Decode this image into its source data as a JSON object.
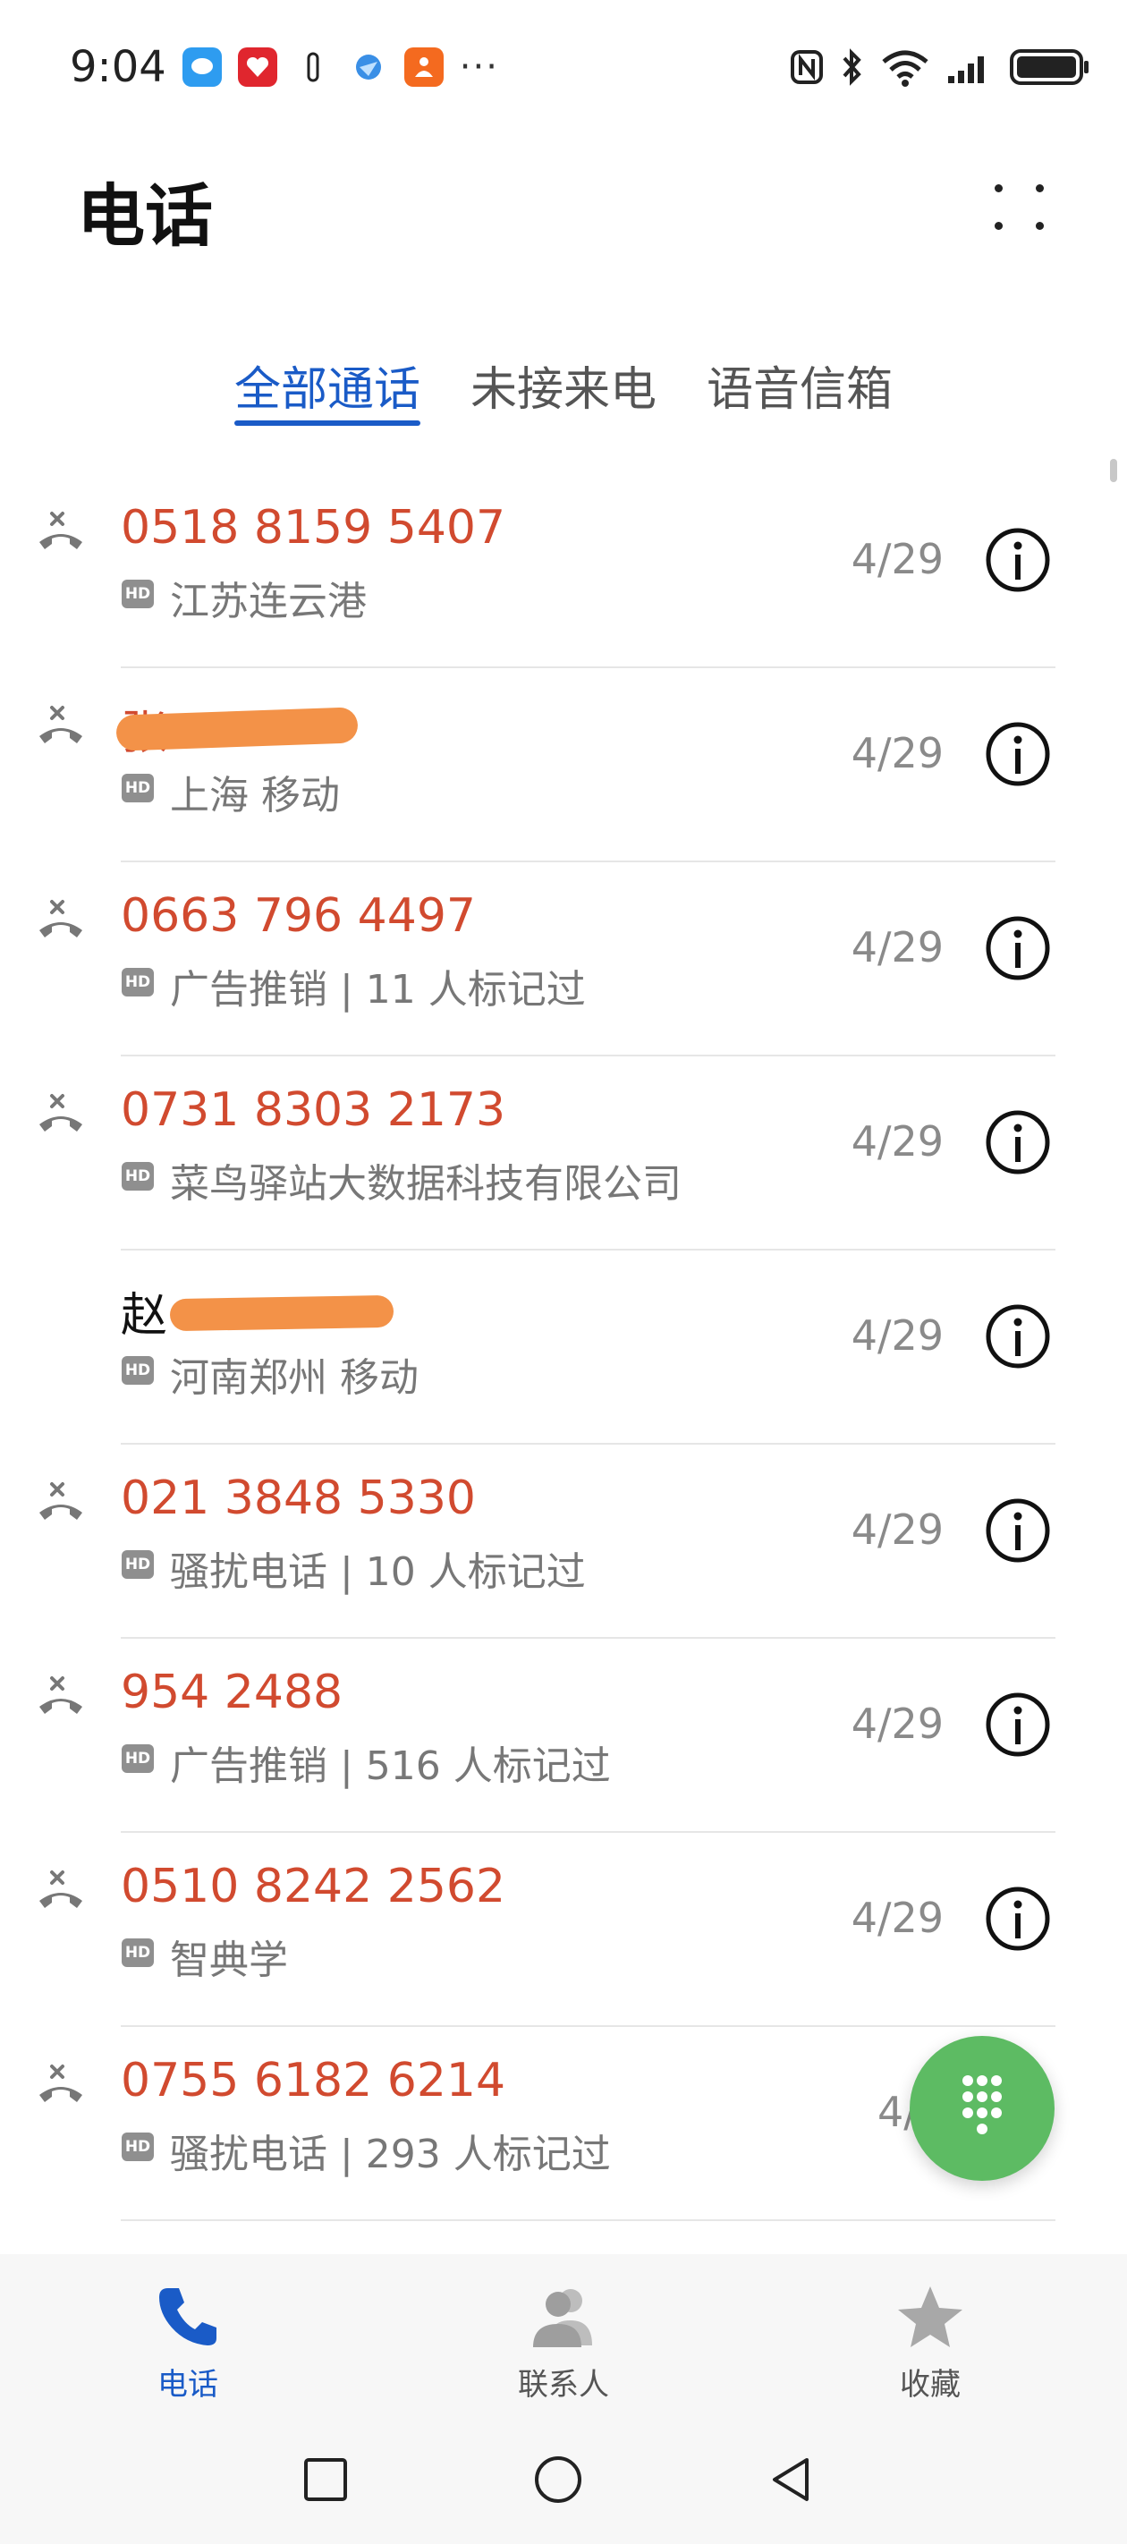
{
  "status_bar": {
    "time": "9:04",
    "more": "···"
  },
  "header": {
    "title": "电话"
  },
  "tabs": [
    {
      "label": "全部通话",
      "active": true
    },
    {
      "label": "未接来电",
      "active": false
    },
    {
      "label": "语音信箱",
      "active": false
    }
  ],
  "calls": [
    {
      "name": "0518 8159 5407",
      "sub": "江苏连云港",
      "date": "4/29",
      "missed": true
    },
    {
      "name": "张",
      "sub": "上海 移动",
      "date": "4/29",
      "missed": true
    },
    {
      "name": "0663 796 4497",
      "sub": "广告推销 | 11 人标记过",
      "date": "4/29",
      "missed": true
    },
    {
      "name": "0731 8303 2173",
      "sub": "菜鸟驿站大数据科技有限公司",
      "date": "4/29",
      "missed": true
    },
    {
      "name": "赵",
      "sub": "河南郑州 移动",
      "date": "4/29",
      "missed": false
    },
    {
      "name": "021 3848 5330",
      "sub": "骚扰电话 | 10 人标记过",
      "date": "4/29",
      "missed": true
    },
    {
      "name": "954 2488",
      "sub": "广告推销 | 516 人标记过",
      "date": "4/29",
      "missed": true
    },
    {
      "name": "0510 8242 2562",
      "sub": "智典学",
      "date": "4/29",
      "missed": true
    },
    {
      "name": "0755 6182 6214",
      "sub": "骚扰电话 | 293 人标记过",
      "date": "4/2",
      "missed": true
    }
  ],
  "hd_label": "HD",
  "bottom_nav": [
    {
      "label": "电话",
      "active": true
    },
    {
      "label": "联系人",
      "active": false
    },
    {
      "label": "收藏",
      "active": false
    }
  ],
  "colors": {
    "accent": "#1a5bc7",
    "missed": "#d14a2f",
    "fab": "#5dbb63"
  }
}
